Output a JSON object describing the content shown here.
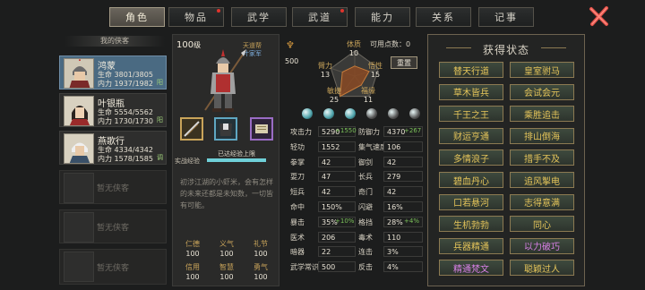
{
  "tabs": [
    {
      "label": "角色",
      "active": true,
      "dot": false
    },
    {
      "label": "物品",
      "active": false,
      "dot": true
    },
    {
      "label": "武学",
      "active": false,
      "dot": false
    },
    {
      "label": "武道",
      "active": false,
      "dot": true
    },
    {
      "label": "能力",
      "active": false,
      "dot": false
    },
    {
      "label": "关系",
      "active": false,
      "dot": false
    },
    {
      "label": "记事",
      "active": false,
      "dot": false
    }
  ],
  "party": {
    "header": "我的侠客",
    "heroes": [
      {
        "name": "鸿蒙",
        "hp": "生命 3801/3805",
        "mp": "内力 1937/1982",
        "tag": "阳"
      },
      {
        "name": "叶银瓶",
        "hp": "生命 5554/5562",
        "mp": "内力 1730/1730",
        "tag": "阳"
      },
      {
        "name": "燕歌行",
        "hp": "生命 4334/4342",
        "mp": "内力 1578/1585",
        "tag": "调"
      }
    ],
    "empty": [
      "暂无侠客",
      "暂无侠客",
      "暂无侠客",
      "暂无侠客"
    ]
  },
  "profile": {
    "level_num": "100",
    "level_unit": "级",
    "faction": "天道帮",
    "title": "叶家军",
    "coin": "500",
    "exp_label": "实战经验",
    "exp_text": "已达经验上限",
    "exp_fraction": 1.0,
    "bio": "初涉江湖的小虾米，会有怎样的未来还都是未知数，一切皆有可能。",
    "virtues": [
      {
        "k": "仁德",
        "v": "100"
      },
      {
        "k": "义气",
        "v": "100"
      },
      {
        "k": "礼节",
        "v": "100"
      },
      {
        "k": "信用",
        "v": "100"
      },
      {
        "k": "智慧",
        "v": "100"
      },
      {
        "k": "勇气",
        "v": "100"
      }
    ]
  },
  "radar": {
    "points_label": "可用点数：",
    "points": "0",
    "reset": "重置",
    "attrs": [
      {
        "k": "体质",
        "v": "10"
      },
      {
        "k": "悟性",
        "v": "15"
      },
      {
        "k": "福缘",
        "v": "11"
      },
      {
        "k": "敏捷",
        "v": "25"
      },
      {
        "k": "臂力",
        "v": "13"
      }
    ],
    "values": [
      10,
      15,
      11,
      25,
      13
    ]
  },
  "stats": {
    "rows": [
      {
        "k1": "攻击力",
        "v1": "5290",
        "p1": "+1550",
        "k2": "防御力",
        "v2": "4370",
        "p2": "+267"
      },
      {
        "k1": "轻功",
        "v1": "1552",
        "p1": "",
        "k2": "集气速度",
        "v2": "106",
        "p2": ""
      },
      {
        "k1": "拳掌",
        "v1": "42",
        "p1": "",
        "k2": "御剑",
        "v2": "42",
        "p2": ""
      },
      {
        "k1": "耍刀",
        "v1": "47",
        "p1": "",
        "k2": "长兵",
        "v2": "279",
        "p2": ""
      },
      {
        "k1": "短兵",
        "v1": "42",
        "p1": "",
        "k2": "奇门",
        "v2": "42",
        "p2": ""
      },
      {
        "k1": "命中",
        "v1": "150%",
        "p1": "",
        "k2": "闪避",
        "v2": "16%",
        "p2": ""
      },
      {
        "k1": "暴击",
        "v1": "35%",
        "p1": "+10%",
        "k2": "格挡",
        "v2": "28%",
        "p2": "+4%"
      },
      {
        "k1": "医术",
        "v1": "206",
        "p1": "",
        "k2": "毒术",
        "v2": "110",
        "p2": ""
      },
      {
        "k1": "暗器",
        "v1": "22",
        "p1": "",
        "k2": "连击",
        "v2": "3%",
        "p2": ""
      },
      {
        "k1": "武学常识",
        "v1": "500",
        "p1": "",
        "k2": "反击",
        "v2": "4%",
        "p2": ""
      }
    ]
  },
  "status": {
    "title": "获得状态",
    "items": [
      {
        "label": "替天行道",
        "purple": false
      },
      {
        "label": "皇室驸马",
        "purple": false
      },
      {
        "label": "草木皆兵",
        "purple": false
      },
      {
        "label": "会试会元",
        "purple": false
      },
      {
        "label": "千王之王",
        "purple": false
      },
      {
        "label": "乘胜追击",
        "purple": false
      },
      {
        "label": "财运亨通",
        "purple": false
      },
      {
        "label": "排山倒海",
        "purple": false
      },
      {
        "label": "多情浪子",
        "purple": false
      },
      {
        "label": "措手不及",
        "purple": false
      },
      {
        "label": "碧血丹心",
        "purple": false
      },
      {
        "label": "追风掣电",
        "purple": false
      },
      {
        "label": "口若悬河",
        "purple": false
      },
      {
        "label": "志得意满",
        "purple": false
      },
      {
        "label": "生机勃勃",
        "purple": false
      },
      {
        "label": "同心",
        "purple": false
      },
      {
        "label": "兵器精通",
        "purple": false
      },
      {
        "label": "以力破巧",
        "purple": true
      },
      {
        "label": "精通梵文",
        "purple": true
      },
      {
        "label": "聪颖过人",
        "purple": false
      }
    ]
  },
  "colors": {
    "gold": "#e5c55a",
    "purple": "#d880e6",
    "green": "#7cc25a",
    "selected": "#4a6a82"
  }
}
